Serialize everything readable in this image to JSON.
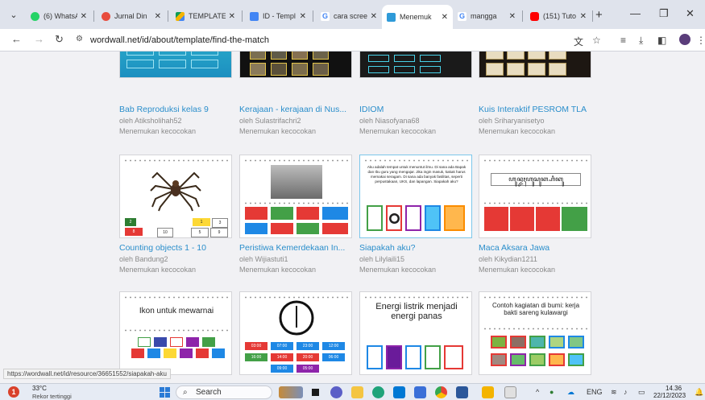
{
  "browser": {
    "tabs": [
      {
        "label": "(6) WhatsA",
        "fav_color": "#25d366"
      },
      {
        "label": "Jurnal Din",
        "fav_color": "#e84c3d"
      },
      {
        "label": "TEMPLATE",
        "fav_color": "#f4b400"
      },
      {
        "label": "ID - Templ",
        "fav_color": "#4285f4"
      },
      {
        "label": "cara screen",
        "fav_color": "#4285f4"
      },
      {
        "label": "Menemuk",
        "fav_color": "#2e9ad8",
        "active": true
      },
      {
        "label": "mangga",
        "fav_color": "#4285f4"
      },
      {
        "label": "(151) Tuto",
        "fav_color": "#ff0000"
      }
    ],
    "url": "wordwall.net/id/about/template/find-the-match",
    "new_tab": "+",
    "minimize": "—",
    "restore": "❐",
    "close": "✕"
  },
  "cards": [
    {
      "title": "Bab Reproduksi kelas 9",
      "author": "oleh Atiksholihah52",
      "type": "Menemukan kecocokan"
    },
    {
      "title": "Kerajaan - kerajaan di Nus...",
      "author": "oleh Sulastrifachri2",
      "type": "Menemukan kecocokan"
    },
    {
      "title": "IDIOM",
      "author": "oleh Niasofyana68",
      "type": "Menemukan kecocokan"
    },
    {
      "title": "Kuis Interaktif PESROM TLA",
      "author": "oleh Sriharyanisetyo",
      "type": "Menemukan kecocokan"
    },
    {
      "title": "Counting objects 1 - 10",
      "author": "oleh Bandung2",
      "type": "Menemukan kecocokan"
    },
    {
      "title": "Peristiwa Kemerdekaan In...",
      "author": "oleh Wijiastuti1",
      "type": "Menemukan kecocokan"
    },
    {
      "title": "Siapakah aku?",
      "author": "oleh Lilylaili15",
      "type": "Menemukan kecocokan"
    },
    {
      "title": "Maca Aksara Jawa",
      "author": "oleh Kikydian1211",
      "type": "Menemukan kecocokan"
    }
  ],
  "thumbs": {
    "siapakah_text": "Aku adalah tempat untuk menuntut ilmu. Di sana ada Bapak dan Ibu guru yang mengajar. Jika ingin masuk, kakak harus memakai seragam. Di sana ada banyak fasilitas, seperti perpustakaan, UKS, dan lapangan. Siapakah aku?",
    "aksara_text": "ꦲꦸꦤ꧀ꦢꦃꦲꦸꦱꦸꦏ꧀ꦲꦶꦏꦸ",
    "ikon_text": "Ikon untuk mewarnai",
    "energi_text": "Energi listrik menjadi energi panas",
    "contoh_text": "Contoh kagiatan di bumi: kerja bakti sareng kulawargi",
    "counting_nums": [
      "2",
      "1",
      "3",
      "8",
      "10",
      "5",
      "9"
    ],
    "clock_times": [
      "03:00",
      "07:00",
      "23:00",
      "12:00",
      "16:00",
      "14:00",
      "20:00",
      "06:00",
      "09:00",
      "05:00"
    ]
  },
  "status_link": "https://wordwall.net/id/resource/36651552/siapakah-aku",
  "taskbar": {
    "weather_badge": "1",
    "temp": "33°C",
    "weather": "Rekor tertinggi",
    "search": "Search",
    "lang": "ENG",
    "time": "14.36",
    "date": "22/12/2023"
  }
}
